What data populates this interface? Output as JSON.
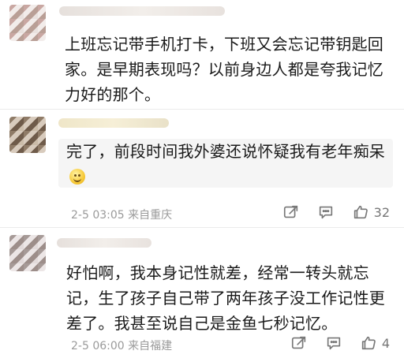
{
  "comments": [
    {
      "text": "上班忘记带手机打卡，下班又会忘记带钥匙回家。是早期表现吗？以前身边人都是夸我记忆力好的那个。"
    },
    {
      "reply_text": "完了，前段时间我外婆还说怀疑我有老年痴呆",
      "emoji": "smile-emoji",
      "time": "2-5 03:05",
      "source": "来自重庆",
      "likes": "32"
    },
    {
      "text": "好怕啊，我本身记性就差，经常一转头就忘记，生了孩子自己带了两年孩子没工作记性更差了。我甚至说自己是金鱼七秒记忆。",
      "time": "2-5 06:00",
      "source": "来自福建",
      "likes": "4"
    }
  ],
  "icons": {
    "share": "share-icon",
    "comment": "comment-icon",
    "like": "thumbs-up-icon"
  },
  "colors": {
    "meta_text": "#9a9a9a",
    "reply_bg": "#f5f5f5"
  }
}
